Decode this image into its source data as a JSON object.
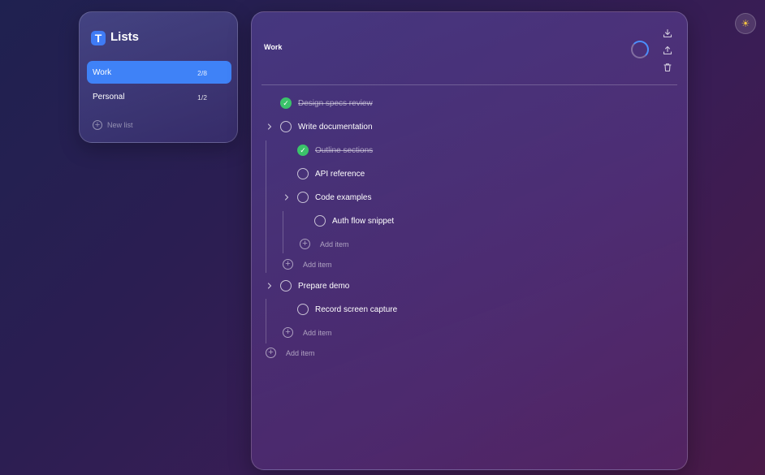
{
  "sidebar": {
    "logo_letter": "T",
    "title": "Lists",
    "lists": [
      {
        "name": "Work",
        "count": "2/8",
        "active": true
      },
      {
        "name": "Personal",
        "count": "1/2",
        "active": false
      }
    ],
    "new_list_label": "New list"
  },
  "main": {
    "title": "Work",
    "actions": [
      "download-icon",
      "upload-icon",
      "trash-icon"
    ],
    "tasks": [
      {
        "label": "Design specs review",
        "done": true
      },
      {
        "label": "Write documentation",
        "done": false
      },
      {
        "label": "Outline sections",
        "done": true
      },
      {
        "label": "API reference",
        "done": false
      },
      {
        "label": "Code examples",
        "done": false
      },
      {
        "label": "Auth flow snippet",
        "done": false
      },
      {
        "label": "Prepare demo",
        "done": false
      },
      {
        "label": "Record screen capture",
        "done": false
      }
    ],
    "add_item_label": "Add item"
  },
  "theme_toggle": {
    "icon": "sun-icon"
  },
  "colors": {
    "accent": "#3f82f7",
    "done": "#3bc36a",
    "spinner": "#4b90ff"
  }
}
